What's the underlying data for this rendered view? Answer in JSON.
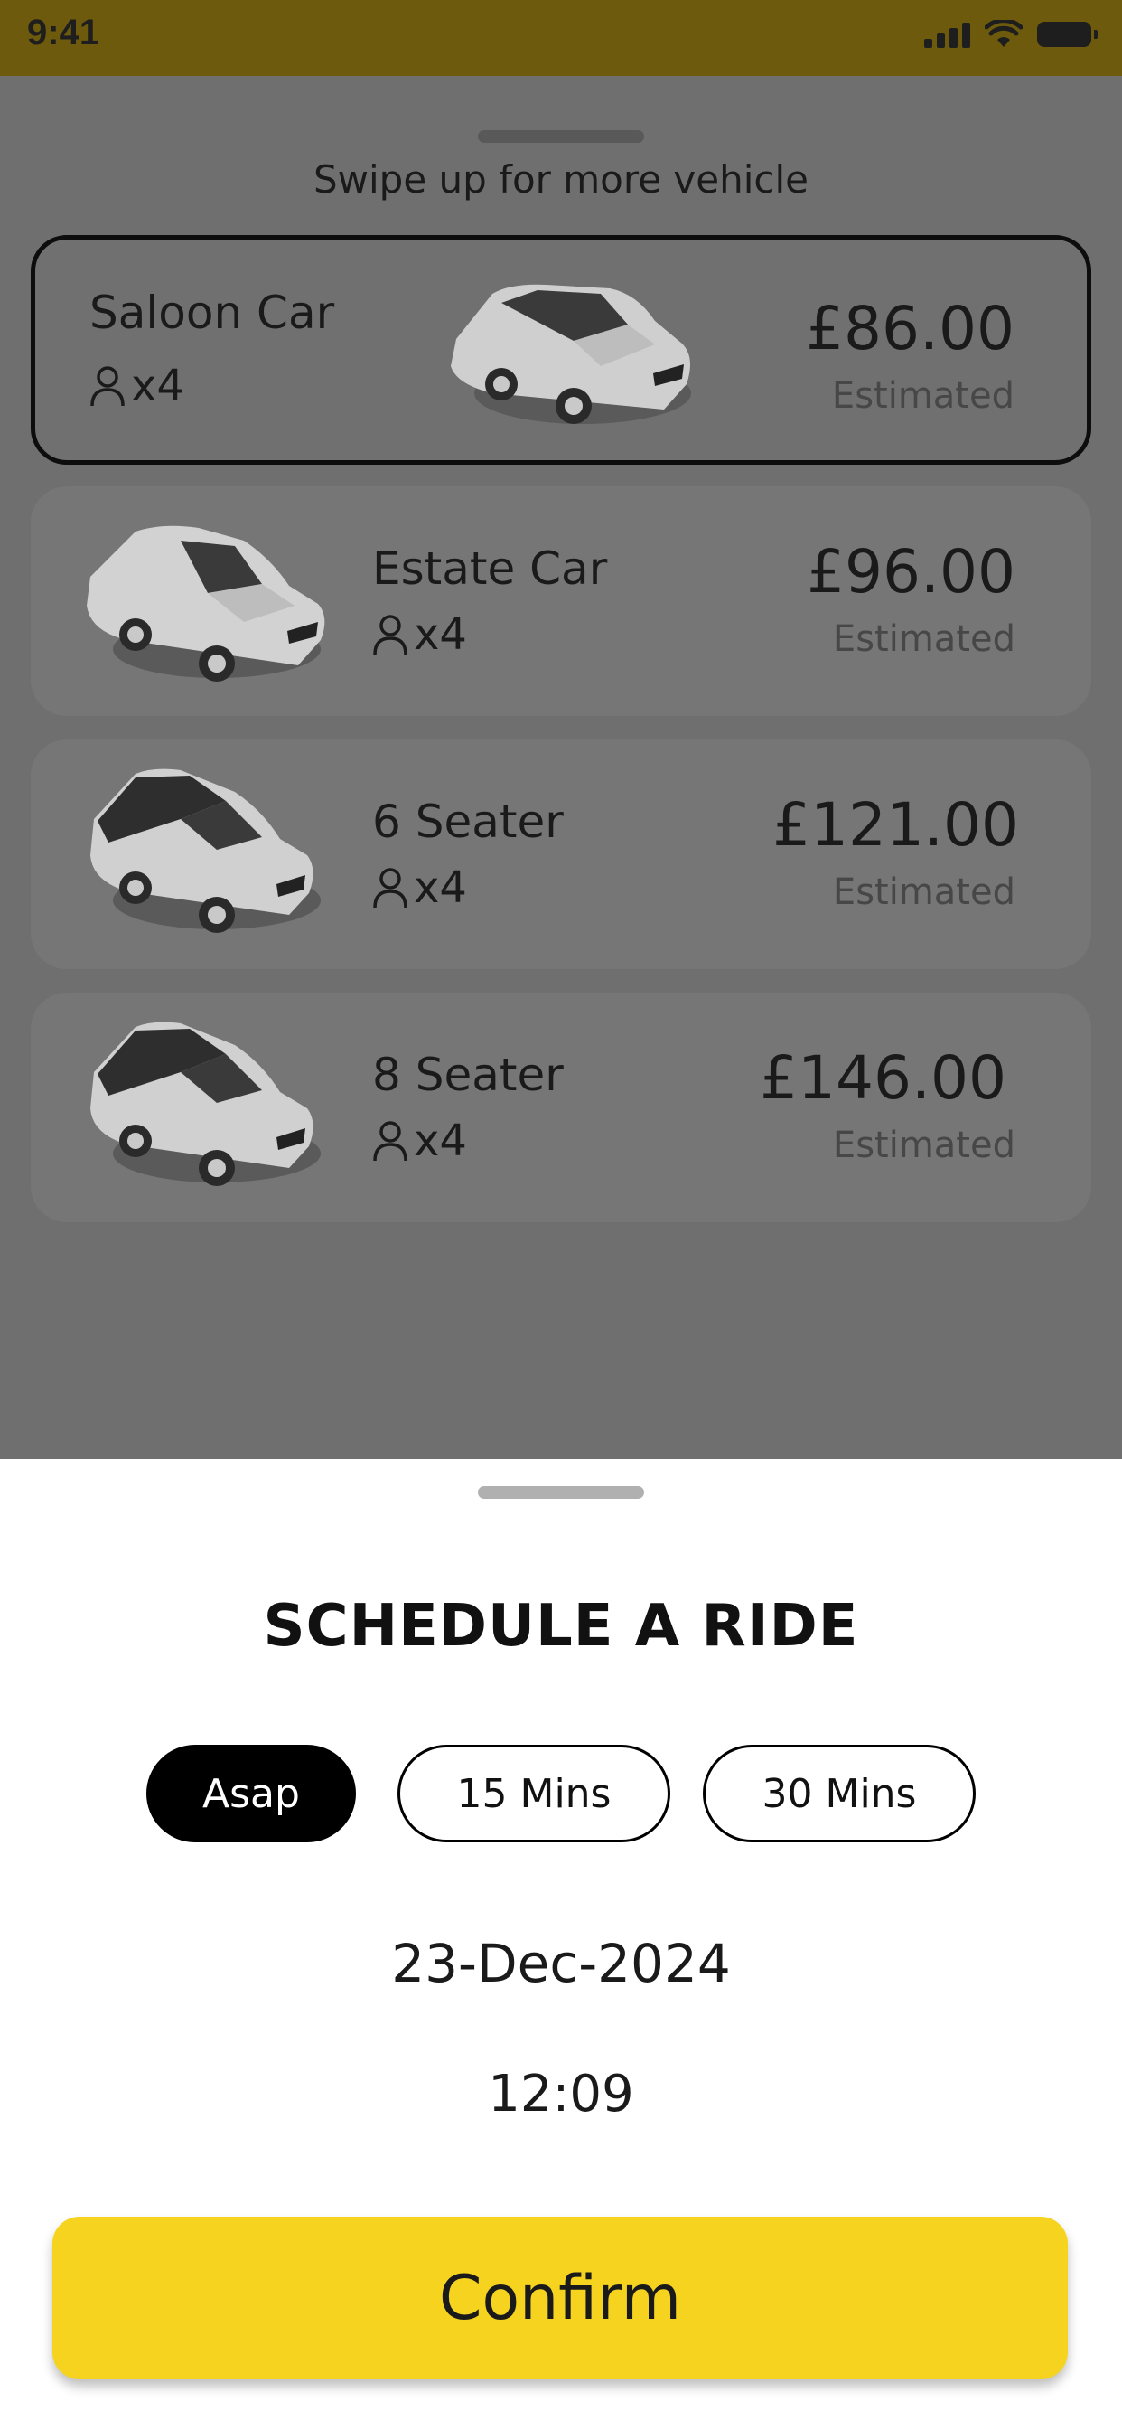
{
  "status_bar": {
    "time": "9:41"
  },
  "vehicles_panel": {
    "hint": "Swipe up for more vehicle",
    "vehicles": [
      {
        "name": "Saloon Car",
        "passengers": "x4",
        "price": "£86.00",
        "note": "Estimated",
        "selected": true
      },
      {
        "name": "Estate Car",
        "passengers": "x4",
        "price": "£96.00",
        "note": "Estimated",
        "selected": false
      },
      {
        "name": "6 Seater",
        "passengers": "x4",
        "price": "£121.00",
        "note": "Estimated",
        "selected": false
      },
      {
        "name": "8 Seater",
        "passengers": "x4",
        "price": "£146.00",
        "note": "Estimated",
        "selected": false
      }
    ]
  },
  "schedule": {
    "title": "SCHEDULE A RIDE",
    "options": [
      {
        "label": "Asap",
        "active": true
      },
      {
        "label": "15 Mins",
        "active": false
      },
      {
        "label": "30 Mins",
        "active": false
      }
    ],
    "date": "23-Dec-2024",
    "time": "12:09",
    "confirm_label": "Confirm"
  },
  "colors": {
    "accent": "#f5d31e",
    "status_bar": "#6e5a0c",
    "overlay": "#6f6f6f"
  }
}
